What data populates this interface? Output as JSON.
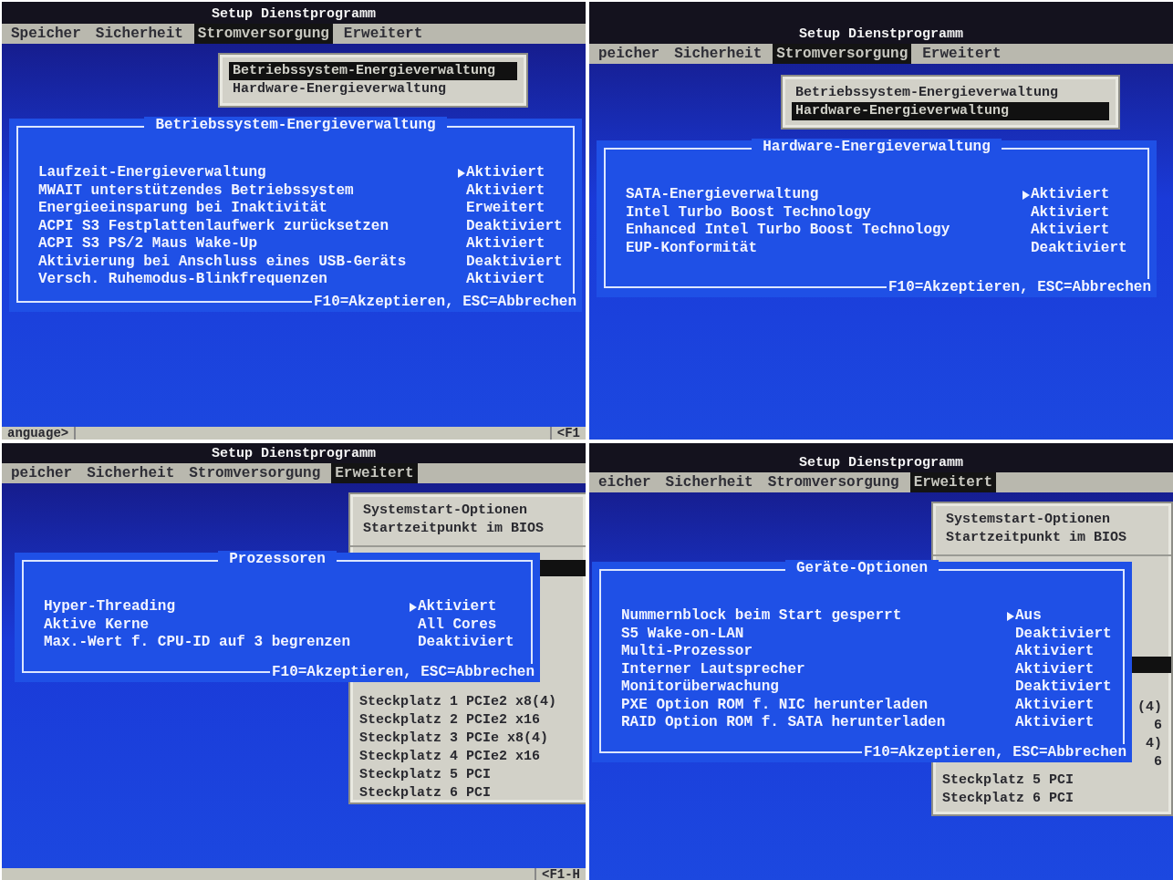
{
  "panels": [
    {
      "title": "Setup Dienstprogramm",
      "tabs": [
        {
          "label": "Speicher",
          "selected": false
        },
        {
          "label": "Sicherheit",
          "selected": false
        },
        {
          "label": "Stromversorgung",
          "selected": true
        },
        {
          "label": "Erweitert",
          "selected": false
        }
      ],
      "submenu": {
        "items": [
          {
            "label": "Betriebssystem-Energieverwaltung",
            "selected": true
          },
          {
            "label": "Hardware-Energieverwaltung",
            "selected": false
          }
        ]
      },
      "dialog": {
        "title": "Betriebssystem-Energieverwaltung",
        "rows": [
          {
            "label": "Laufzeit-Energieverwaltung",
            "value": "Aktiviert",
            "focused": true
          },
          {
            "label": "MWAIT unterstützendes Betriebssystem",
            "value": "Aktiviert",
            "focused": false
          },
          {
            "label": "Energieeinsparung bei Inaktivität",
            "value": "Erweitert",
            "focused": false
          },
          {
            "label": "ACPI S3 Festplattenlaufwerk zurücksetzen",
            "value": "Deaktiviert",
            "focused": false
          },
          {
            "label": "ACPI S3 PS/2 Maus Wake-Up",
            "value": "Aktiviert",
            "focused": false
          },
          {
            "label": "Aktivierung bei Anschluss eines USB-Geräts",
            "value": "Deaktiviert",
            "focused": false
          },
          {
            "label": "Versch. Ruhemodus-Blinkfrequenzen",
            "value": "Aktiviert",
            "focused": false
          }
        ],
        "footer": "F10=Akzeptieren, ESC=Abbrechen"
      },
      "status": {
        "left": "anguage>",
        "right": "<F1"
      }
    },
    {
      "title": "Setup Dienstprogramm",
      "tabs": [
        {
          "label": "peicher",
          "selected": false
        },
        {
          "label": "Sicherheit",
          "selected": false
        },
        {
          "label": "Stromversorgung",
          "selected": true
        },
        {
          "label": "Erweitert",
          "selected": false
        }
      ],
      "submenu": {
        "items": [
          {
            "label": "Betriebssystem-Energieverwaltung",
            "selected": false
          },
          {
            "label": "Hardware-Energieverwaltung",
            "selected": true
          }
        ]
      },
      "dialog": {
        "title": "Hardware-Energieverwaltung",
        "rows": [
          {
            "label": "SATA-Energieverwaltung",
            "value": "Aktiviert",
            "focused": true
          },
          {
            "label": "Intel Turbo Boost Technology",
            "value": "Aktiviert",
            "focused": false
          },
          {
            "label": "Enhanced Intel Turbo Boost Technology",
            "value": "Aktiviert",
            "focused": false
          },
          {
            "label": "EUP-Konformität",
            "value": "Deaktiviert",
            "focused": false
          }
        ],
        "footer": "F10=Akzeptieren, ESC=Abbrechen"
      }
    },
    {
      "title": "Setup Dienstprogramm",
      "tabs": [
        {
          "label": "peicher",
          "selected": false
        },
        {
          "label": "Sicherheit",
          "selected": false
        },
        {
          "label": "Stromversorgung",
          "selected": false
        },
        {
          "label": "Erweitert",
          "selected": true
        }
      ],
      "submenu": {
        "items": [
          {
            "label": "Systemstart-Optionen",
            "selected": false
          },
          {
            "label": "Startzeitpunkt im BIOS",
            "selected": false
          }
        ],
        "covered_selected": true,
        "slots": [
          {
            "kind": "full",
            "label": "Steckplatz 1 PCIe2 x8(4)"
          },
          {
            "kind": "full",
            "label": "Steckplatz 2 PCIe2 x16"
          },
          {
            "kind": "full",
            "label": "Steckplatz 3 PCIe x8(4)"
          },
          {
            "kind": "full",
            "label": "Steckplatz 4 PCIe2 x16"
          },
          {
            "kind": "full",
            "label": "Steckplatz 5 PCI"
          },
          {
            "kind": "full",
            "label": "Steckplatz 6 PCI"
          }
        ]
      },
      "dialog": {
        "title": "Prozessoren",
        "rows": [
          {
            "label": "Hyper-Threading",
            "value": "Aktiviert",
            "focused": true
          },
          {
            "label": "Aktive Kerne",
            "value": "All Cores",
            "focused": false
          },
          {
            "label": "Max.-Wert f. CPU-ID auf 3 begrenzen",
            "value": "Deaktiviert",
            "focused": false
          }
        ],
        "footer": "F10=Akzeptieren, ESC=Abbrechen"
      },
      "status": {
        "right": "<F1-H"
      }
    },
    {
      "title": "Setup Dienstprogramm",
      "tabs": [
        {
          "label": "eicher",
          "selected": false
        },
        {
          "label": "Sicherheit",
          "selected": false
        },
        {
          "label": "Stromversorgung",
          "selected": false
        },
        {
          "label": "Erweitert",
          "selected": true
        }
      ],
      "submenu": {
        "items": [
          {
            "label": "Systemstart-Optionen",
            "selected": false
          },
          {
            "label": "Startzeitpunkt im BIOS",
            "selected": false
          }
        ],
        "covered_selected": true,
        "slots": [
          {
            "kind": "tail",
            "label": "(4)"
          },
          {
            "kind": "tail",
            "label": "6"
          },
          {
            "kind": "tail",
            "label": "4)"
          },
          {
            "kind": "tail",
            "label": "6"
          },
          {
            "kind": "full",
            "label": "Steckplatz 5 PCI"
          },
          {
            "kind": "full",
            "label": "Steckplatz 6 PCI"
          }
        ]
      },
      "dialog": {
        "title": "Geräte-Optionen",
        "rows": [
          {
            "label": "Nummernblock beim Start gesperrt",
            "value": "Aus",
            "focused": true
          },
          {
            "label": "S5 Wake-on-LAN",
            "value": "Deaktiviert",
            "focused": false
          },
          {
            "label": "Multi-Prozessor",
            "value": "Aktiviert",
            "focused": false
          },
          {
            "label": "Interner Lautsprecher",
            "value": "Aktiviert",
            "focused": false
          },
          {
            "label": "Monitorüberwachung",
            "value": "Deaktiviert",
            "focused": false
          },
          {
            "label": "PXE Option ROM f. NIC herunterladen",
            "value": "Aktiviert",
            "focused": false
          },
          {
            "label": "RAID Option ROM f. SATA herunterladen",
            "value": "Aktiviert",
            "focused": false
          }
        ],
        "footer": "F10=Akzeptieren, ESC=Abbrechen"
      }
    }
  ]
}
